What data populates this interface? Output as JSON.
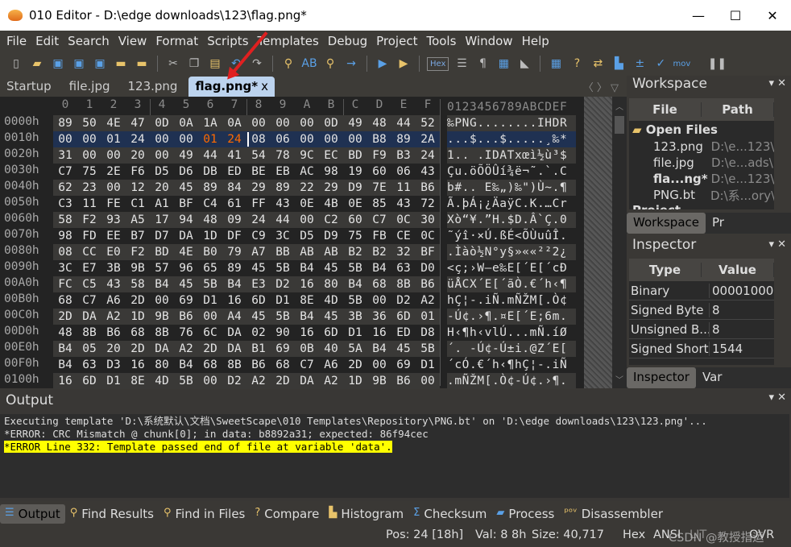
{
  "window": {
    "title": "010 Editor - D:\\edge downloads\\123\\flag.png*",
    "minimize": "—",
    "maximize": "☐",
    "close": "✕"
  },
  "menu": [
    "File",
    "Edit",
    "Search",
    "View",
    "Format",
    "Scripts",
    "Templates",
    "Debug",
    "Project",
    "Tools",
    "Window",
    "Help"
  ],
  "toolbar": {
    "hex_label": "Hex",
    "mov_label": "mov"
  },
  "tabs": [
    {
      "label": "Startup"
    },
    {
      "label": "file.jpg"
    },
    {
      "label": "123.png"
    },
    {
      "label": "flag.png*",
      "close": "x",
      "active": true
    }
  ],
  "editor": {
    "col_headers": [
      "0",
      "1",
      "2",
      "3",
      "4",
      "5",
      "6",
      "7",
      "8",
      "9",
      "A",
      "B",
      "C",
      "D",
      "E",
      "F"
    ],
    "ascii_header": "0123456789ABCDEF",
    "highlight_color": "#ff6a00",
    "rows": [
      {
        "addr": "0000h",
        "bytes": [
          "89",
          "50",
          "4E",
          "47",
          "0D",
          "0A",
          "1A",
          "0A",
          "00",
          "00",
          "00",
          "0D",
          "49",
          "48",
          "44",
          "52"
        ],
        "ascii": "‰PNG........IHDR"
      },
      {
        "addr": "0010h",
        "bytes": [
          "00",
          "00",
          "01",
          "24",
          "00",
          "00",
          "01",
          "24",
          "08",
          "06",
          "00",
          "00",
          "00",
          "B8",
          "89",
          "2A"
        ],
        "ascii": "...$...$.....¸‰*",
        "selected": true
      },
      {
        "addr": "0020h",
        "bytes": [
          "31",
          "00",
          "00",
          "20",
          "00",
          "49",
          "44",
          "41",
          "54",
          "78",
          "9C",
          "EC",
          "BD",
          "F9",
          "B3",
          "24"
        ],
        "ascii": "1.. .IDATxœì½ù³$"
      },
      {
        "addr": "0030h",
        "bytes": [
          "C7",
          "75",
          "2E",
          "F6",
          "D5",
          "D6",
          "DB",
          "ED",
          "BE",
          "EB",
          "AC",
          "98",
          "19",
          "60",
          "06",
          "43"
        ],
        "ascii": "Çu.öÕÖÛí¾ë¬˜.`.C"
      },
      {
        "addr": "0040h",
        "bytes": [
          "62",
          "23",
          "00",
          "12",
          "20",
          "45",
          "89",
          "84",
          "29",
          "89",
          "22",
          "29",
          "D9",
          "7E",
          "11",
          "B6"
        ],
        "ascii": "b#.. E‰„)‰\")Ù~.¶"
      },
      {
        "addr": "0050h",
        "bytes": [
          "C3",
          "11",
          "FE",
          "C1",
          "A1",
          "BF",
          "C4",
          "61",
          "FF",
          "43",
          "0E",
          "4B",
          "0E",
          "85",
          "43",
          "72"
        ],
        "ascii": "Ã.þÁ¡¿ÄaÿC.K.…Cr"
      },
      {
        "addr": "0060h",
        "bytes": [
          "58",
          "F2",
          "93",
          "A5",
          "17",
          "94",
          "48",
          "09",
          "24",
          "44",
          "00",
          "C2",
          "60",
          "C7",
          "0C",
          "30"
        ],
        "ascii": "Xò“¥.”H.$D.Â`Ç.0"
      },
      {
        "addr": "0070h",
        "bytes": [
          "98",
          "FD",
          "EE",
          "B7",
          "D7",
          "DA",
          "1D",
          "DF",
          "C9",
          "3C",
          "D5",
          "D9",
          "75",
          "FB",
          "CE",
          "0C"
        ],
        "ascii": "˜ýî·×Ú.ßÉ<ÕÙuûÎ."
      },
      {
        "addr": "0080h",
        "bytes": [
          "08",
          "CC",
          "E0",
          "F2",
          "BD",
          "4E",
          "B0",
          "79",
          "A7",
          "BB",
          "AB",
          "AB",
          "B2",
          "B2",
          "32",
          "BF"
        ],
        "ascii": ".Ìàò½N°y§»««²²2¿"
      },
      {
        "addr": "0090h",
        "bytes": [
          "3C",
          "E7",
          "3B",
          "9B",
          "57",
          "96",
          "65",
          "89",
          "45",
          "5B",
          "B4",
          "45",
          "5B",
          "B4",
          "63",
          "D0"
        ],
        "ascii": "<ç;›W–e‰E[´E[´cÐ"
      },
      {
        "addr": "00A0h",
        "bytes": [
          "FC",
          "C5",
          "43",
          "58",
          "B4",
          "45",
          "5B",
          "B4",
          "E3",
          "D2",
          "16",
          "80",
          "B4",
          "68",
          "8B",
          "B6"
        ],
        "ascii": "üÅCX´E[´ãÒ.€´h‹¶"
      },
      {
        "addr": "00B0h",
        "bytes": [
          "68",
          "C7",
          "A6",
          "2D",
          "00",
          "69",
          "D1",
          "16",
          "6D",
          "D1",
          "8E",
          "4D",
          "5B",
          "00",
          "D2",
          "A2"
        ],
        "ascii": "hÇ¦-.iÑ.mÑŽM[.Ò¢"
      },
      {
        "addr": "00C0h",
        "bytes": [
          "2D",
          "DA",
          "A2",
          "1D",
          "9B",
          "B6",
          "00",
          "A4",
          "45",
          "5B",
          "B4",
          "45",
          "3B",
          "36",
          "6D",
          "01"
        ],
        "ascii": "-Ú¢.›¶.¤E[´E;6m."
      },
      {
        "addr": "00D0h",
        "bytes": [
          "48",
          "8B",
          "B6",
          "68",
          "8B",
          "76",
          "6C",
          "DA",
          "02",
          "90",
          "16",
          "6D",
          "D1",
          "16",
          "ED",
          "D8"
        ],
        "ascii": "H‹¶h‹vlÚ...mÑ.íØ"
      },
      {
        "addr": "00E0h",
        "bytes": [
          "B4",
          "05",
          "20",
          "2D",
          "DA",
          "A2",
          "2D",
          "DA",
          "B1",
          "69",
          "0B",
          "40",
          "5A",
          "B4",
          "45",
          "5B"
        ],
        "ascii": "´. -Ú¢-Ú±i.@Z´E["
      },
      {
        "addr": "00F0h",
        "bytes": [
          "B4",
          "63",
          "D3",
          "16",
          "80",
          "B4",
          "68",
          "8B",
          "B6",
          "68",
          "C7",
          "A6",
          "2D",
          "00",
          "69",
          "D1"
        ],
        "ascii": "´cÓ.€´h‹¶hÇ¦-.iÑ"
      },
      {
        "addr": "0100h",
        "bytes": [
          "16",
          "6D",
          "D1",
          "8E",
          "4D",
          "5B",
          "00",
          "D2",
          "A2",
          "2D",
          "DA",
          "A2",
          "1D",
          "9B",
          "B6",
          "00"
        ],
        "ascii": ".mÑŽM[.Ò¢-Ú¢.›¶."
      }
    ]
  },
  "workspace": {
    "title": "Workspace",
    "col_file": "File",
    "col_path": "Path",
    "group_open": "Open Files",
    "files": [
      {
        "name": "123.png",
        "path": "D:\\e...123\\"
      },
      {
        "name": "file.jpg",
        "path": "D:\\e...ads\\"
      },
      {
        "name": "fla...ng*",
        "path": "D:\\e...123\\",
        "bold": true
      },
      {
        "name": "PNG.bt",
        "path": "D:\\系...ory\\"
      }
    ],
    "group_project": "Project",
    "tab_workspace": "Workspace",
    "tab_project": "Pr"
  },
  "inspector": {
    "title": "Inspector",
    "col_type": "Type",
    "col_value": "Value",
    "rows": [
      {
        "type": "Binary",
        "value": "00001000"
      },
      {
        "type": "Signed Byte",
        "value": "8"
      },
      {
        "type": "Unsigned B...",
        "value": "8"
      },
      {
        "type": "Signed Short",
        "value": "1544"
      }
    ],
    "tab_inspector": "Inspector",
    "tab_vars": "Var"
  },
  "output": {
    "title": "Output",
    "lines": [
      "Executing template 'D:\\系统默认\\文档\\SweetScape\\010 Templates\\Repository\\PNG.bt' on 'D:\\edge downloads\\123\\123.png'...",
      "*ERROR: CRC Mismatch @ chunk[0]; in data: b8892a31; expected: 86f94cec",
      "*ERROR Line 332: Template passed end of file at variable 'data'."
    ]
  },
  "bottom_tabs": [
    "Output",
    "Find Results",
    "Find in Files",
    "Compare",
    "Histogram",
    "Checksum",
    "Process",
    "Disassembler"
  ],
  "status": {
    "pos": "Pos: 24 [18h]",
    "val": "Val: 8 8h",
    "size": "Size: 40,717",
    "mode": "Hex",
    "encoding": "ANSI",
    "endian": "LIT",
    "ovr": "OVR",
    "watermark": "CSDN @教授指运"
  }
}
